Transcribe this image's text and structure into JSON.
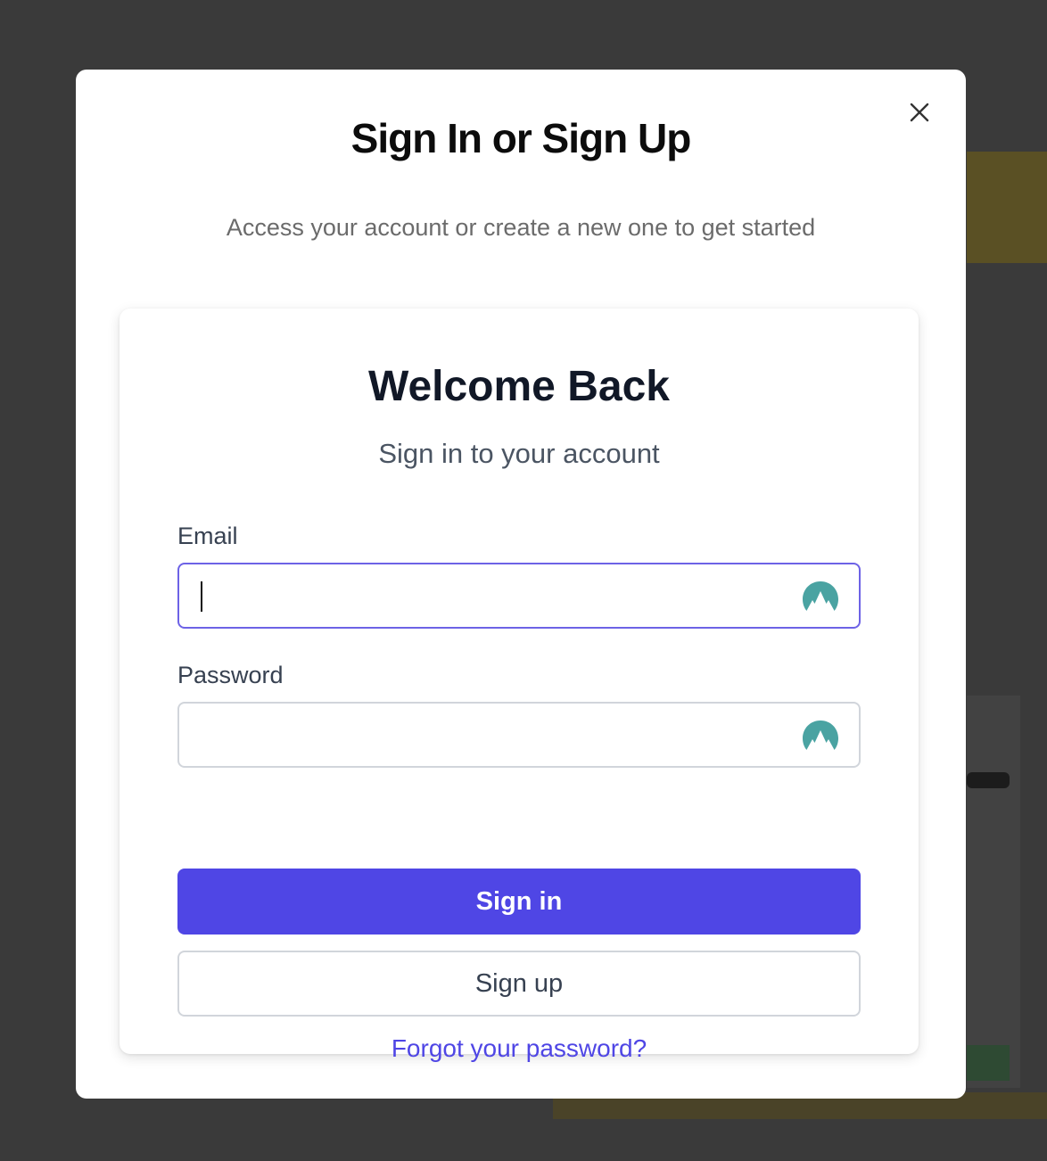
{
  "modal": {
    "title": "Sign In or Sign Up",
    "subtitle": "Access your account or create a new one to get started",
    "close_icon": "close-icon"
  },
  "card": {
    "title": "Welcome Back",
    "subtitle": "Sign in to your account"
  },
  "form": {
    "email": {
      "label": "Email",
      "value": "",
      "placeholder": "",
      "icon": "nordpass-autofill-icon"
    },
    "password": {
      "label": "Password",
      "value": "",
      "placeholder": "",
      "icon": "nordpass-autofill-icon"
    }
  },
  "actions": {
    "sign_in": "Sign in",
    "sign_up": "Sign up",
    "forgot": "Forgot your password?"
  },
  "colors": {
    "primary": "#4f46e5",
    "focus_border": "#6d62e6",
    "autofill_icon": "#4aa3a2",
    "backdrop": "#3a3a3a"
  }
}
